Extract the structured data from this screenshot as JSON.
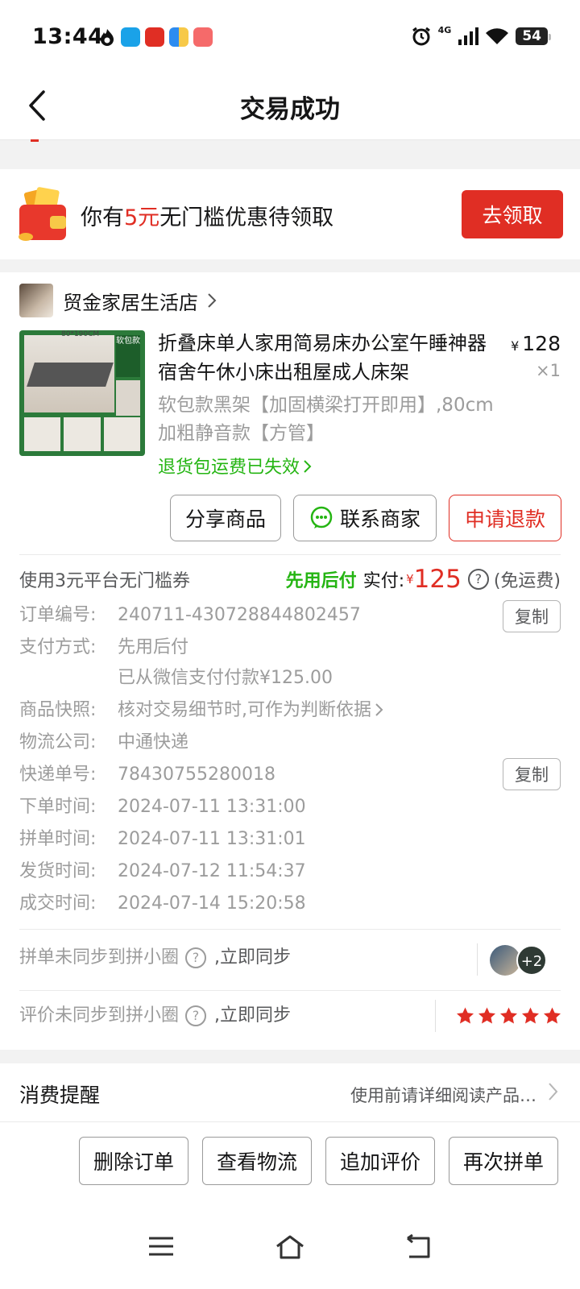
{
  "status_bar": {
    "time": "13:44",
    "network": "4G",
    "battery": "54"
  },
  "nav": {
    "title": "交易成功"
  },
  "coupon": {
    "text_prefix": "你有",
    "amount": "5元",
    "text_suffix": "无门槛优惠待领取",
    "button": "去领取"
  },
  "store": {
    "name": "贸金家居生活店"
  },
  "product": {
    "title": "折叠床单人家用简易床办公室午睡神器宿舍午休小床出租屋成人床架",
    "price_symbol": "¥",
    "price": "128",
    "quantity": "×1",
    "spec": "软包款黑架【加固横梁打开即用】,80cm加粗静音款【方管】",
    "return_note": "退货包运费已失效",
    "image_labels": {
      "size": "80*190CM",
      "tag": "软包款"
    }
  },
  "order_buttons": {
    "share": "分享商品",
    "contact": "联系商家",
    "refund": "申请退款"
  },
  "payment": {
    "coupon_note": "使用3元平台无门槛券",
    "pay_later": "先用后付",
    "paid_label": "实付:",
    "currency": "¥",
    "amount": "125",
    "shipping": "(免运费)"
  },
  "details": {
    "order_no_label": "订单编号:",
    "order_no": "240711-430728844802457",
    "copy": "复制",
    "pay_method_label": "支付方式:",
    "pay_method": "先用后付",
    "pay_method_note": "已从微信支付付款¥125.00",
    "snapshot_label": "商品快照:",
    "snapshot": "核对交易细节时,可作为判断依据",
    "logistics_label": "物流公司:",
    "logistics": "中通快递",
    "tracking_label": "快递单号:",
    "tracking": "78430755280018",
    "order_time_label": "下单时间:",
    "order_time": "2024-07-11 13:31:00",
    "group_time_label": "拼单时间:",
    "group_time": "2024-07-11 13:31:01",
    "ship_time_label": "发货时间:",
    "ship_time": "2024-07-12 11:54:37",
    "deal_time_label": "成交时间:",
    "deal_time": "2024-07-14 15:20:58"
  },
  "sync": {
    "group_text": "拼单未同步到拼小圈",
    "group_action": ",立即同步",
    "avatar_extra": "+2",
    "review_text": "评价未同步到拼小圈",
    "review_action": ",立即同步",
    "rating_stars": 5
  },
  "reminder": {
    "title": "消费提醒",
    "desc": "使用前请详细阅读产品…"
  },
  "actions": {
    "delete": "删除订单",
    "logistics": "查看物流",
    "review": "追加评价",
    "reorder": "再次拼单"
  },
  "colors": {
    "brand_red": "#e02e24",
    "green": "#25b513",
    "star": "#e02e24"
  }
}
